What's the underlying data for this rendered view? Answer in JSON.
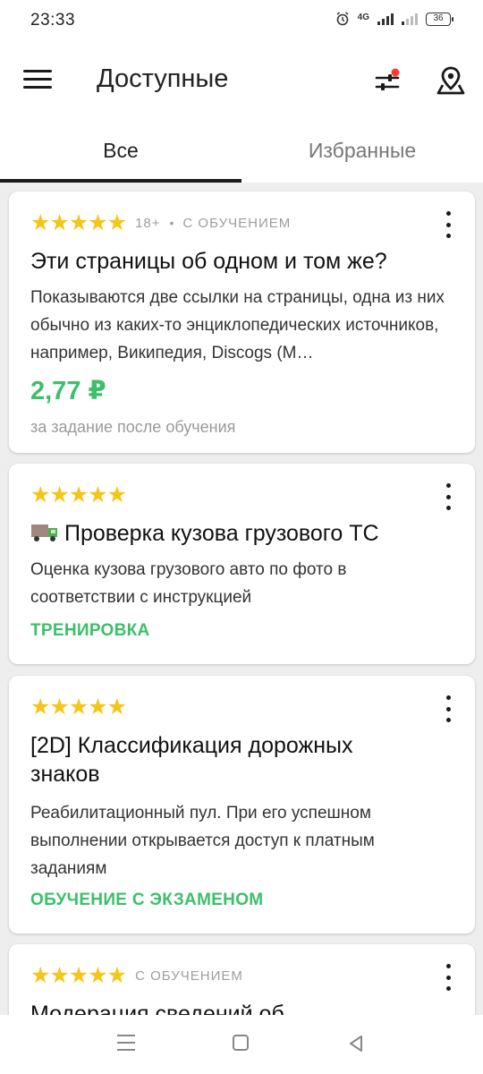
{
  "status_bar": {
    "time": "23:33",
    "network": "4G",
    "battery": "36"
  },
  "app_bar": {
    "title": "Доступные",
    "menu_icon": "hamburger-icon",
    "filter_icon": "sliders-icon",
    "filter_dot_color": "#ff3b30",
    "map_icon": "map-pin-icon"
  },
  "tabs": {
    "all": "Все",
    "favorites": "Избранные",
    "active": "all"
  },
  "colors": {
    "stars": "#f5c518",
    "accent_green": "#3dbf6a",
    "muted": "#9e9e9e"
  },
  "cards": [
    {
      "stars": "★★★★★",
      "age": "18+",
      "dot": "•",
      "badge": "С ОБУЧЕНИЕМ",
      "title": "Эти страницы об одном и том же?",
      "description": "Показываются две ссылки на страницы, одна из них обычно из каких-то энциклопедических источников, например, Википедия, Discogs (M…",
      "price": "2,77 ₽",
      "price_note": "за задание после обучения"
    },
    {
      "stars": "★★★★★",
      "title": "Проверка кузова грузового ТС",
      "title_icon": "truck-icon",
      "description": "Оценка кузова грузового авто по фото в соответствии с инструкцией",
      "tag": "ТРЕНИРОВКА"
    },
    {
      "stars": "★★★★★",
      "title": "[2D] Классификация дорожных знаков",
      "description": "Реабилитационный пул. При его успешном выполнении открывается доступ к платным заданиям",
      "tag": "ОБУЧЕНИЕ С ЭКЗАМЕНОМ"
    },
    {
      "stars": "★★★★★",
      "badge": "С ОБУЧЕНИЕМ",
      "title": "Модерация сведений об"
    }
  ]
}
